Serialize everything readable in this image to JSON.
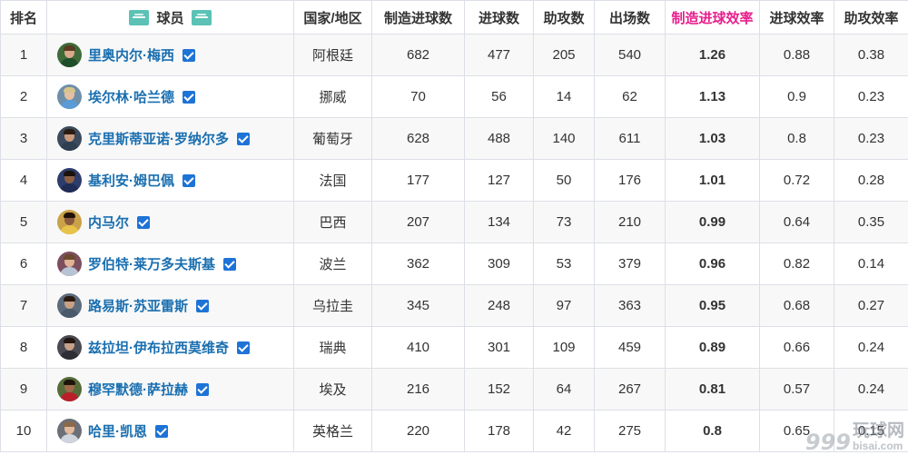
{
  "headers": {
    "rank": "排名",
    "player": "球员",
    "country": "国家/地区",
    "goal_contrib": "制造进球数",
    "goals": "进球数",
    "assists": "助攻数",
    "apps": "出场数",
    "contrib_eff": "制造进球效率",
    "goal_eff": "进球效率",
    "assist_eff": "助攻效率"
  },
  "colors": {
    "highlight": "#e91e8c",
    "player_link": "#1a6fb0",
    "country_link": "#1b6fb5",
    "checkbox": "#1e73d6",
    "club_logo": "#5cc2b5"
  },
  "icons": {
    "club_logo": "club-logo-icon",
    "verified": "checkbox-checked-icon"
  },
  "rows": [
    {
      "rank": "1",
      "player": "里奥内尔·梅西",
      "country": "阿根廷",
      "goal_contrib": "682",
      "goals": "477",
      "assists": "205",
      "apps": "540",
      "contrib_eff": "1.26",
      "goal_eff": "0.88",
      "assist_eff": "0.38"
    },
    {
      "rank": "2",
      "player": "埃尔林·哈兰德",
      "country": "挪威",
      "goal_contrib": "70",
      "goals": "56",
      "assists": "14",
      "apps": "62",
      "contrib_eff": "1.13",
      "goal_eff": "0.9",
      "assist_eff": "0.23"
    },
    {
      "rank": "3",
      "player": "克里斯蒂亚诺·罗纳尔多",
      "country": "葡萄牙",
      "goal_contrib": "628",
      "goals": "488",
      "assists": "140",
      "apps": "611",
      "contrib_eff": "1.03",
      "goal_eff": "0.8",
      "assist_eff": "0.23"
    },
    {
      "rank": "4",
      "player": "基利安·姆巴佩",
      "country": "法国",
      "goal_contrib": "177",
      "goals": "127",
      "assists": "50",
      "apps": "176",
      "contrib_eff": "1.01",
      "goal_eff": "0.72",
      "assist_eff": "0.28"
    },
    {
      "rank": "5",
      "player": "内马尔",
      "country": "巴西",
      "goal_contrib": "207",
      "goals": "134",
      "assists": "73",
      "apps": "210",
      "contrib_eff": "0.99",
      "goal_eff": "0.64",
      "assist_eff": "0.35"
    },
    {
      "rank": "6",
      "player": "罗伯特·莱万多夫斯基",
      "country": "波兰",
      "goal_contrib": "362",
      "goals": "309",
      "assists": "53",
      "apps": "379",
      "contrib_eff": "0.96",
      "goal_eff": "0.82",
      "assist_eff": "0.14"
    },
    {
      "rank": "7",
      "player": "路易斯·苏亚雷斯",
      "country": "乌拉圭",
      "goal_contrib": "345",
      "goals": "248",
      "assists": "97",
      "apps": "363",
      "contrib_eff": "0.95",
      "goal_eff": "0.68",
      "assist_eff": "0.27"
    },
    {
      "rank": "8",
      "player": "兹拉坦·伊布拉西莫维奇",
      "country": "瑞典",
      "goal_contrib": "410",
      "goals": "301",
      "assists": "109",
      "apps": "459",
      "contrib_eff": "0.89",
      "goal_eff": "0.66",
      "assist_eff": "0.24"
    },
    {
      "rank": "9",
      "player": "穆罕默德·萨拉赫",
      "country": "埃及",
      "goal_contrib": "216",
      "goals": "152",
      "assists": "64",
      "apps": "267",
      "contrib_eff": "0.81",
      "goal_eff": "0.57",
      "assist_eff": "0.24"
    },
    {
      "rank": "10",
      "player": "哈里·凯恩",
      "country": "英格兰",
      "goal_contrib": "220",
      "goals": "178",
      "assists": "42",
      "apps": "275",
      "contrib_eff": "0.8",
      "goal_eff": "0.65",
      "assist_eff": "0.15"
    }
  ],
  "watermark": {
    "number": "999",
    "title": "玩球网",
    "domain": "bisai.com"
  }
}
